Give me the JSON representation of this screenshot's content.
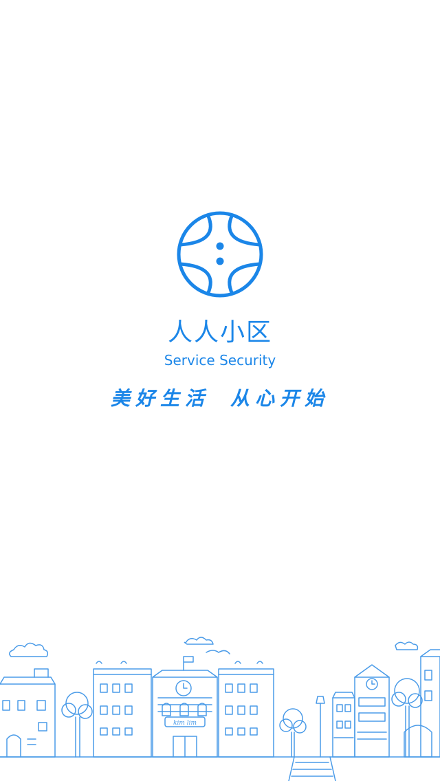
{
  "app": {
    "name": "人人小区",
    "subtitle": "Service Security"
  },
  "slogan": {
    "part1": "美好生活",
    "part2": "从心开始"
  },
  "theme": {
    "accent": "#1b86e8",
    "background": "#ffffff"
  },
  "illustration": {
    "sign_text": "kim lim"
  }
}
